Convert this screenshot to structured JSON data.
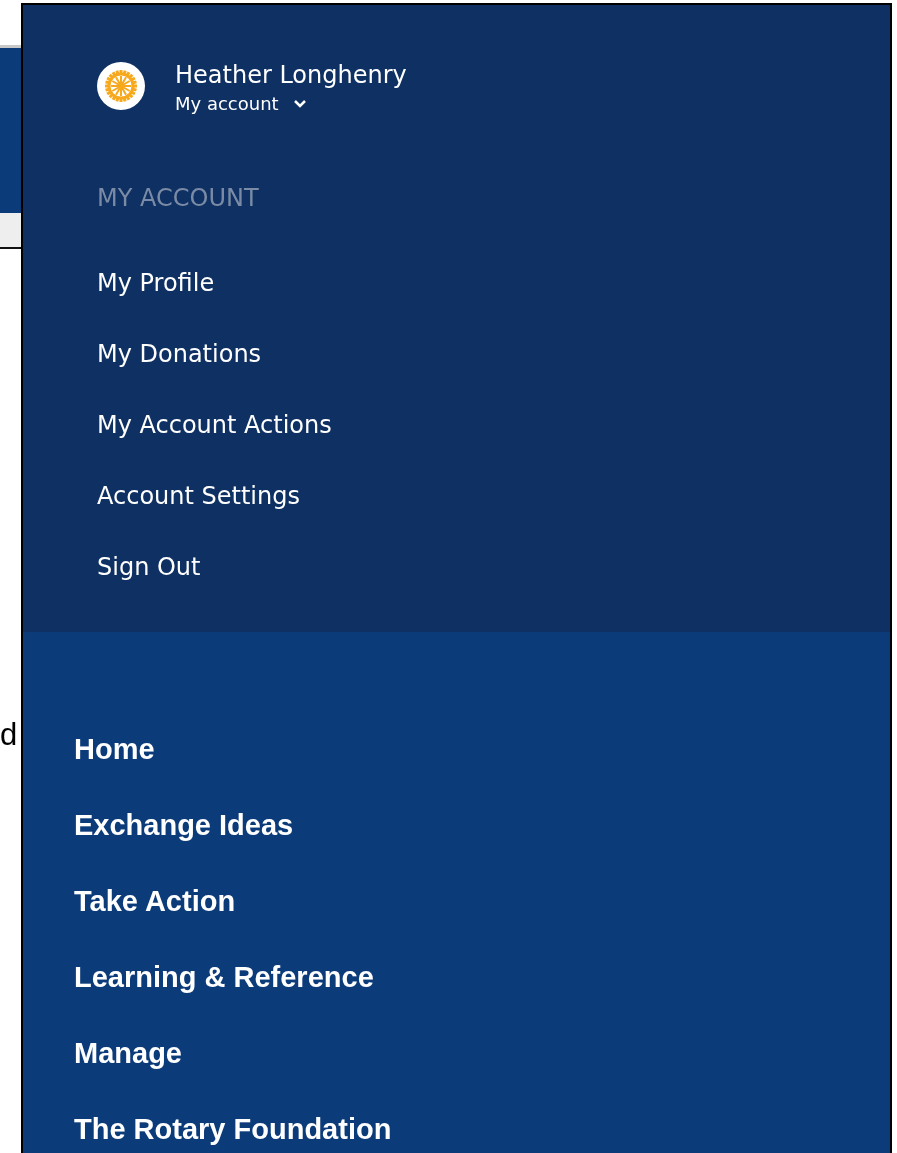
{
  "background": {
    "fragment": "d"
  },
  "user": {
    "name": "Heather Longhenry",
    "account_label": "My account"
  },
  "account_menu": {
    "heading": "MY ACCOUNT",
    "items": [
      {
        "label": "My Profile"
      },
      {
        "label": "My Donations"
      },
      {
        "label": "My Account Actions"
      },
      {
        "label": "Account Settings"
      },
      {
        "label": "Sign Out"
      }
    ]
  },
  "main_nav": [
    {
      "label": "Home"
    },
    {
      "label": "Exchange Ideas"
    },
    {
      "label": "Take Action"
    },
    {
      "label": "Learning & Reference"
    },
    {
      "label": "Manage"
    },
    {
      "label": "The Rotary Foundation"
    }
  ]
}
